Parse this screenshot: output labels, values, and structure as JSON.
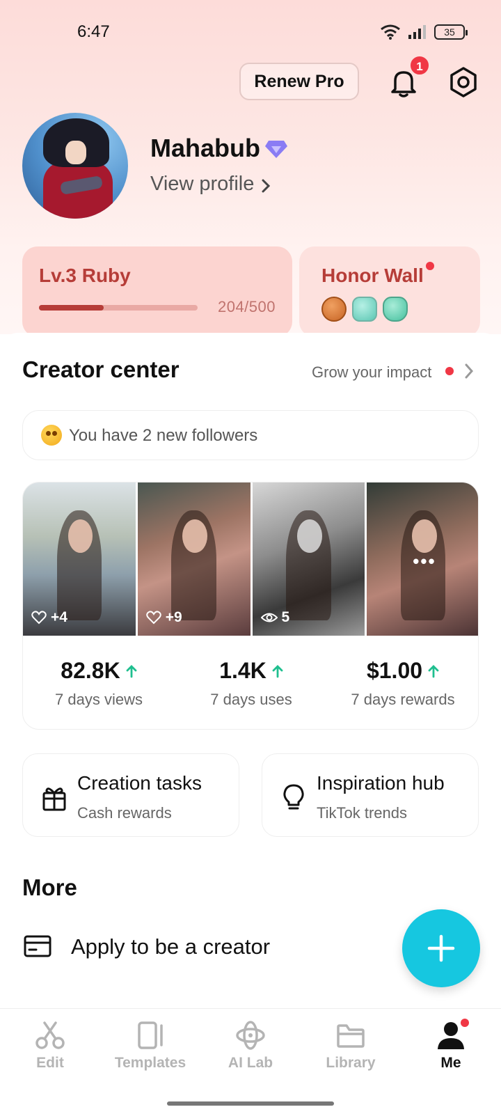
{
  "status_bar": {
    "time": "6:47",
    "battery": "35"
  },
  "header": {
    "renew_label": "Renew Pro",
    "notification_count": "1"
  },
  "profile": {
    "name": "Mahabub",
    "view_profile_label": "View profile"
  },
  "level": {
    "title": "Lv.3 Ruby",
    "progress_text": "204/500",
    "progress_fraction": 0.408
  },
  "honor": {
    "title": "Honor Wall",
    "badge_icons": [
      "bronze-badge-icon",
      "tiktok-badge-icon",
      "green-gem-badge-icon"
    ]
  },
  "creator_center": {
    "title": "Creator center",
    "grow_label": "Grow your impact",
    "followers_text": "You have 2 new followers",
    "thumbnails": [
      {
        "icon": "heart-icon",
        "value": "+4"
      },
      {
        "icon": "heart-icon",
        "value": "+9"
      },
      {
        "icon": "eye-icon",
        "value": "5"
      },
      {
        "icon": "more-icon",
        "value": "•••"
      }
    ],
    "stats": [
      {
        "value": "82.8K",
        "label": "7 days views"
      },
      {
        "value": "1.4K",
        "label": "7 days uses"
      },
      {
        "value": "$1.00",
        "label": "7 days rewards"
      }
    ]
  },
  "tasks": [
    {
      "title": "Creation tasks",
      "subtitle": "Cash rewards",
      "icon": "gift-icon"
    },
    {
      "title": "Inspiration hub",
      "subtitle": "TikTok trends",
      "icon": "lightbulb-icon"
    }
  ],
  "more": {
    "title": "More",
    "apply_label": "Apply to be a creator"
  },
  "bottom_nav": [
    {
      "label": "Edit",
      "icon": "scissors-icon"
    },
    {
      "label": "Templates",
      "icon": "templates-icon"
    },
    {
      "label": "AI Lab",
      "icon": "ai-lab-icon"
    },
    {
      "label": "Library",
      "icon": "folder-icon"
    },
    {
      "label": "Me",
      "icon": "person-icon",
      "active": true
    }
  ],
  "colors": {
    "accent": "#16c7e0",
    "ruby": "#b63d38",
    "badge_red": "#f03745",
    "up_green": "#1fbf8f"
  }
}
